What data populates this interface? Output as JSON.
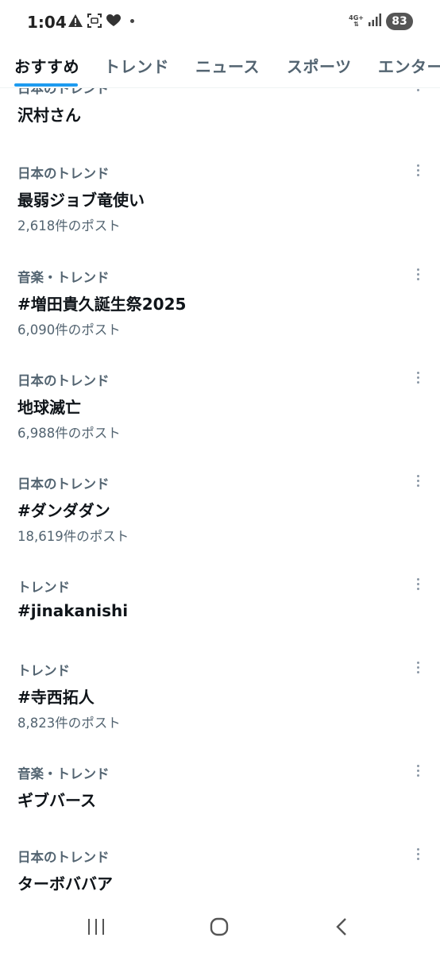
{
  "status_bar": {
    "time": "1:04",
    "network": "4G+",
    "battery": "83",
    "icons": [
      "warning-icon",
      "screenshot-icon",
      "heart-icon",
      "notification-dot-icon",
      "signal-icon"
    ]
  },
  "tabs": [
    {
      "label": "おすすめ",
      "active": true
    },
    {
      "label": "トレンド",
      "active": false
    },
    {
      "label": "ニュース",
      "active": false
    },
    {
      "label": "スポーツ",
      "active": false
    },
    {
      "label": "エンター",
      "active": false
    }
  ],
  "trends": [
    {
      "category": "日本のトレンド",
      "name": "沢村さん",
      "count": ""
    },
    {
      "category": "日本のトレンド",
      "name": "最弱ジョブ竜使い",
      "count": "2,618件のポスト"
    },
    {
      "category": "音楽・トレンド",
      "name": "#増田貴久誕生祭2025",
      "count": "6,090件のポスト"
    },
    {
      "category": "日本のトレンド",
      "name": "地球滅亡",
      "count": "6,988件のポスト"
    },
    {
      "category": "日本のトレンド",
      "name": "#ダンダダン",
      "count": "18,619件のポスト"
    },
    {
      "category": "トレンド",
      "name": "#jinakanishi",
      "count": ""
    },
    {
      "category": "トレンド",
      "name": "#寺西拓人",
      "count": "8,823件のポスト"
    },
    {
      "category": "音楽・トレンド",
      "name": "ギブバース",
      "count": ""
    },
    {
      "category": "日本のトレンド",
      "name": "ターボババア",
      "count": ""
    }
  ],
  "nav_bar": {
    "icons": [
      "recent-apps-icon",
      "home-icon",
      "back-icon"
    ]
  },
  "colors": {
    "accent": "#1d9bf0",
    "text_primary": "#0f1419",
    "text_secondary": "#536471"
  }
}
